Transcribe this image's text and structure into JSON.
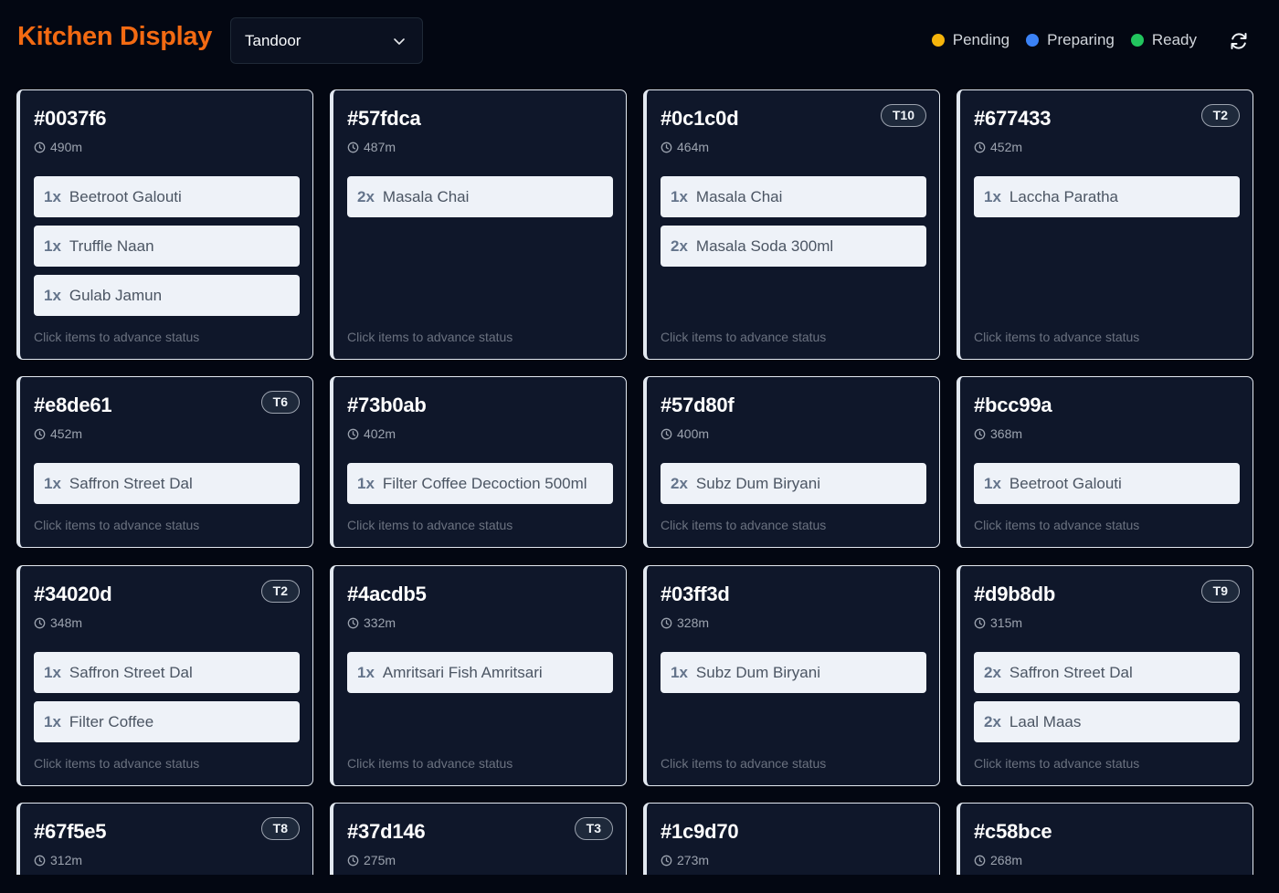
{
  "header": {
    "title": "Kitchen Display",
    "station_select": {
      "value": "Tandoor"
    },
    "legend": [
      {
        "label": "Pending",
        "color": "#f5b40b"
      },
      {
        "label": "Preparing",
        "color": "#3b82f6"
      },
      {
        "label": "Ready",
        "color": "#22c55e"
      }
    ]
  },
  "hint_text": "Click items to advance status",
  "orders": [
    {
      "id": "#0037f6",
      "elapsed": "490m",
      "table": "",
      "items": [
        {
          "qty": "1x",
          "name": "Beetroot Galouti"
        },
        {
          "qty": "1x",
          "name": "Truffle Naan"
        },
        {
          "qty": "1x",
          "name": "Gulab Jamun"
        }
      ]
    },
    {
      "id": "#57fdca",
      "elapsed": "487m",
      "table": "",
      "items": [
        {
          "qty": "2x",
          "name": "Masala Chai"
        }
      ]
    },
    {
      "id": "#0c1c0d",
      "elapsed": "464m",
      "table": "T10",
      "items": [
        {
          "qty": "1x",
          "name": "Masala Chai"
        },
        {
          "qty": "2x",
          "name": "Masala Soda 300ml"
        }
      ]
    },
    {
      "id": "#677433",
      "elapsed": "452m",
      "table": "T2",
      "items": [
        {
          "qty": "1x",
          "name": "Laccha Paratha"
        }
      ]
    },
    {
      "id": "#e8de61",
      "elapsed": "452m",
      "table": "T6",
      "items": [
        {
          "qty": "1x",
          "name": "Saffron Street Dal"
        }
      ]
    },
    {
      "id": "#73b0ab",
      "elapsed": "402m",
      "table": "",
      "items": [
        {
          "qty": "1x",
          "name": "Filter Coffee Decoction 500ml"
        }
      ]
    },
    {
      "id": "#57d80f",
      "elapsed": "400m",
      "table": "",
      "items": [
        {
          "qty": "2x",
          "name": "Subz Dum Biryani"
        }
      ]
    },
    {
      "id": "#bcc99a",
      "elapsed": "368m",
      "table": "",
      "items": [
        {
          "qty": "1x",
          "name": "Beetroot Galouti"
        }
      ]
    },
    {
      "id": "#34020d",
      "elapsed": "348m",
      "table": "T2",
      "items": [
        {
          "qty": "1x",
          "name": "Saffron Street Dal"
        },
        {
          "qty": "1x",
          "name": "Filter Coffee"
        }
      ]
    },
    {
      "id": "#4acdb5",
      "elapsed": "332m",
      "table": "",
      "items": [
        {
          "qty": "1x",
          "name": "Amritsari Fish Amritsari"
        }
      ]
    },
    {
      "id": "#03ff3d",
      "elapsed": "328m",
      "table": "",
      "items": [
        {
          "qty": "1x",
          "name": "Subz Dum Biryani"
        }
      ]
    },
    {
      "id": "#d9b8db",
      "elapsed": "315m",
      "table": "T9",
      "items": [
        {
          "qty": "2x",
          "name": "Saffron Street Dal"
        },
        {
          "qty": "2x",
          "name": "Laal Maas"
        }
      ]
    },
    {
      "id": "#67f5e5",
      "elapsed": "312m",
      "table": "T8",
      "items": []
    },
    {
      "id": "#37d146",
      "elapsed": "275m",
      "table": "T3",
      "items": []
    },
    {
      "id": "#1c9d70",
      "elapsed": "273m",
      "table": "",
      "items": []
    },
    {
      "id": "#c58bce",
      "elapsed": "268m",
      "table": "",
      "items": []
    }
  ]
}
